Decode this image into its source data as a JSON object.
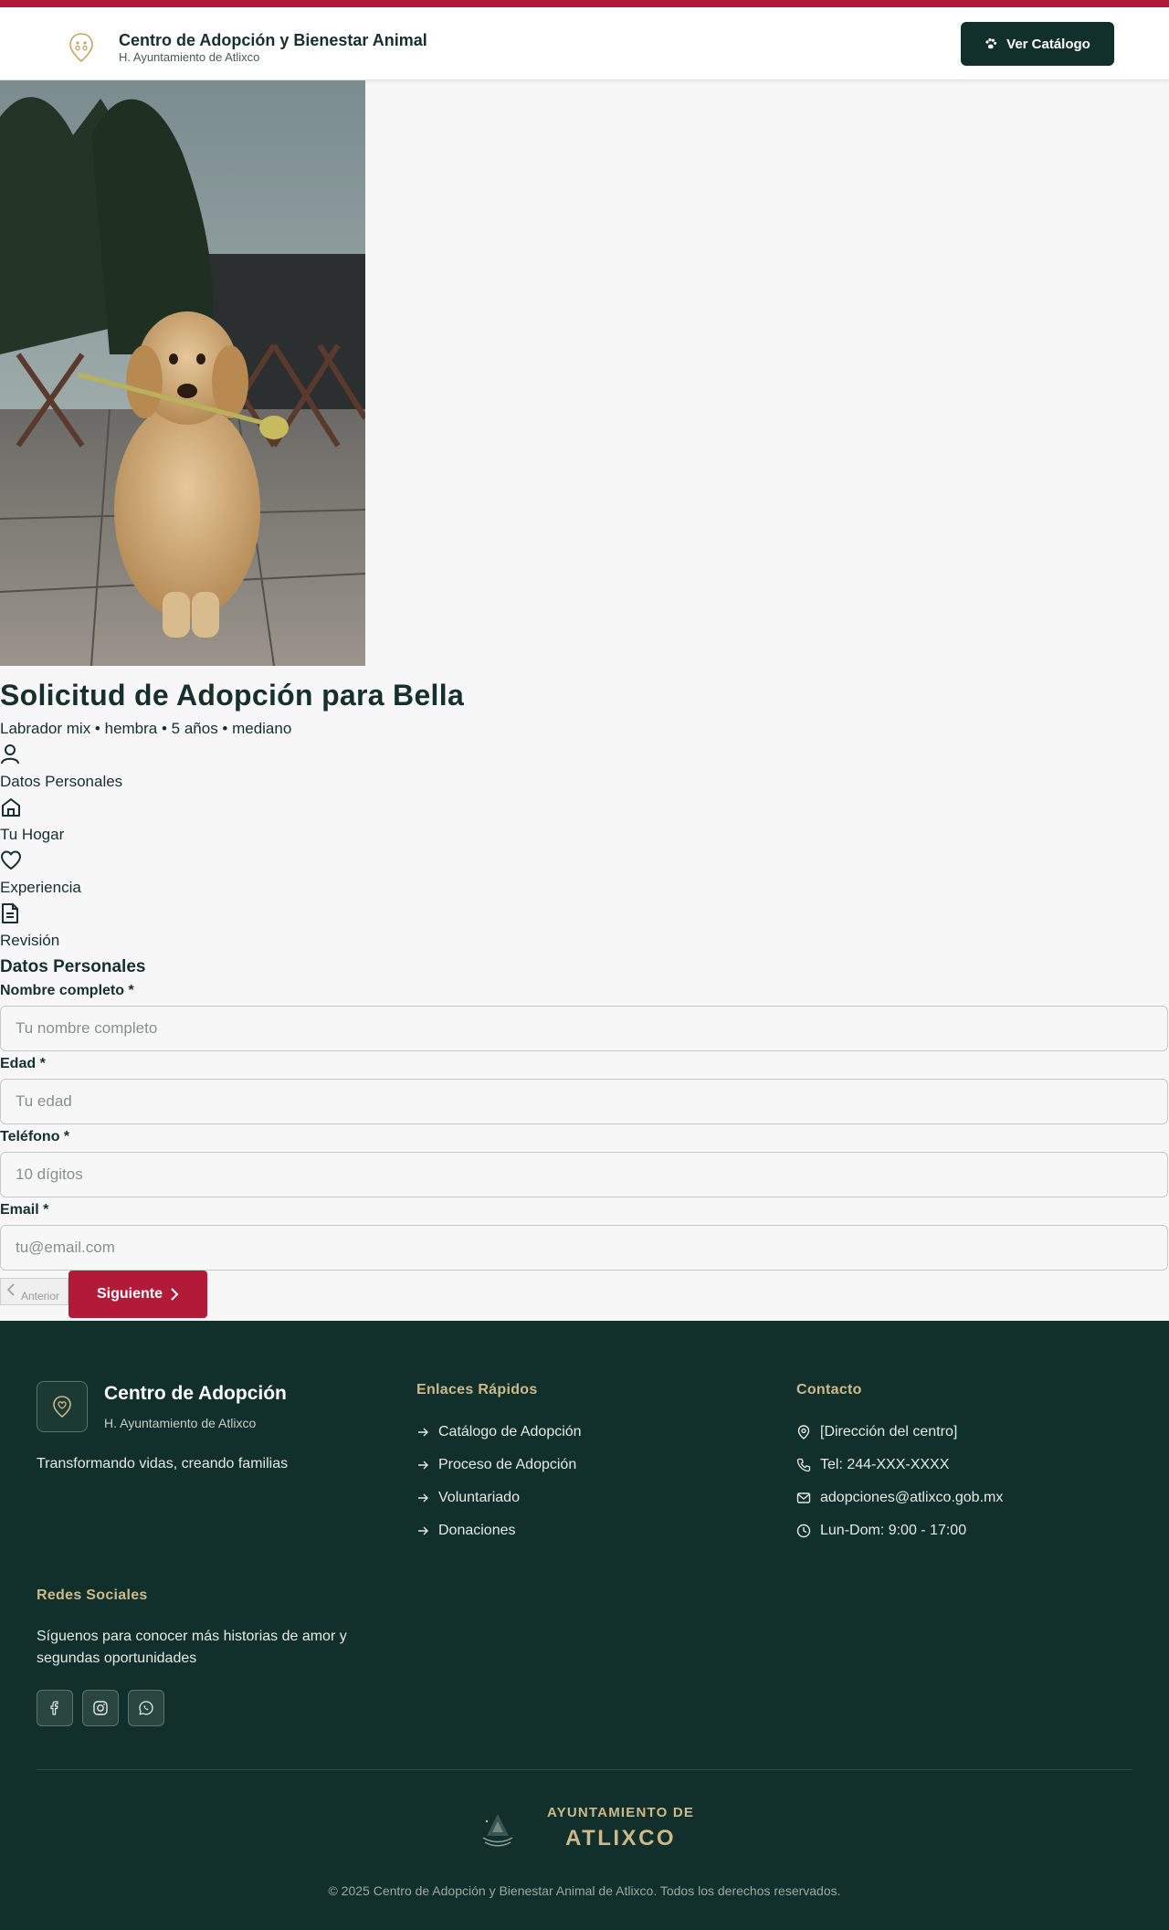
{
  "header": {
    "title": "Centro de Adopción y Bienestar Animal",
    "subtitle": "H. Ayuntamiento de Atlixco",
    "catalog_button": "Ver Catálogo"
  },
  "application": {
    "title": "Solicitud de Adopción para Bella",
    "meta": "Labrador mix • hembra • 5 años • mediano",
    "steps": [
      {
        "label": "Datos Personales",
        "icon": "user-icon"
      },
      {
        "label": "Tu Hogar",
        "icon": "home-icon"
      },
      {
        "label": "Experiencia",
        "icon": "heart-icon"
      },
      {
        "label": "Revisión",
        "icon": "document-icon"
      }
    ],
    "section_title": "Datos Personales",
    "fields": [
      {
        "label": "Nombre completo *",
        "placeholder": "Tu nombre completo"
      },
      {
        "label": "Edad *",
        "placeholder": "Tu edad"
      },
      {
        "label": "Teléfono *",
        "placeholder": "10 dígitos"
      },
      {
        "label": "Email *",
        "placeholder": "tu@email.com"
      }
    ],
    "prev_button": "Anterior",
    "next_button": "Siguiente"
  },
  "footer": {
    "brand_title": "Centro de Adopción",
    "brand_subtitle": "H. Ayuntamiento de Atlixco",
    "tagline": "Transformando vidas, creando familias",
    "links_heading": "Enlaces Rápidos",
    "links": [
      "Catálogo de Adopción",
      "Proceso de Adopción",
      "Voluntariado",
      "Donaciones"
    ],
    "contact_heading": "Contacto",
    "contact": [
      {
        "icon": "map-pin-icon",
        "text": "[Dirección del centro]"
      },
      {
        "icon": "phone-icon",
        "text": "Tel: 244-XXX-XXXX"
      },
      {
        "icon": "mail-icon",
        "text": "adopciones@atlixco.gob.mx"
      },
      {
        "icon": "clock-icon",
        "text": "Lun-Dom: 9:00 - 17:00"
      }
    ],
    "social_heading": "Redes Sociales",
    "social_text": "Síguenos para conocer más historias de amor y segundas oportunidades",
    "socials": [
      "facebook-icon",
      "instagram-icon",
      "whatsapp-icon"
    ],
    "ayto_de": "AYUNTAMIENTO DE",
    "ayto_name": "ATLIXCO",
    "copyright": "© 2025 Centro de Adopción y Bienestar Animal de Atlixco. Todos los derechos reservados."
  },
  "colors": {
    "accent_red": "#b31a38",
    "dark_green": "#12302b",
    "gold": "#cdb98a"
  }
}
